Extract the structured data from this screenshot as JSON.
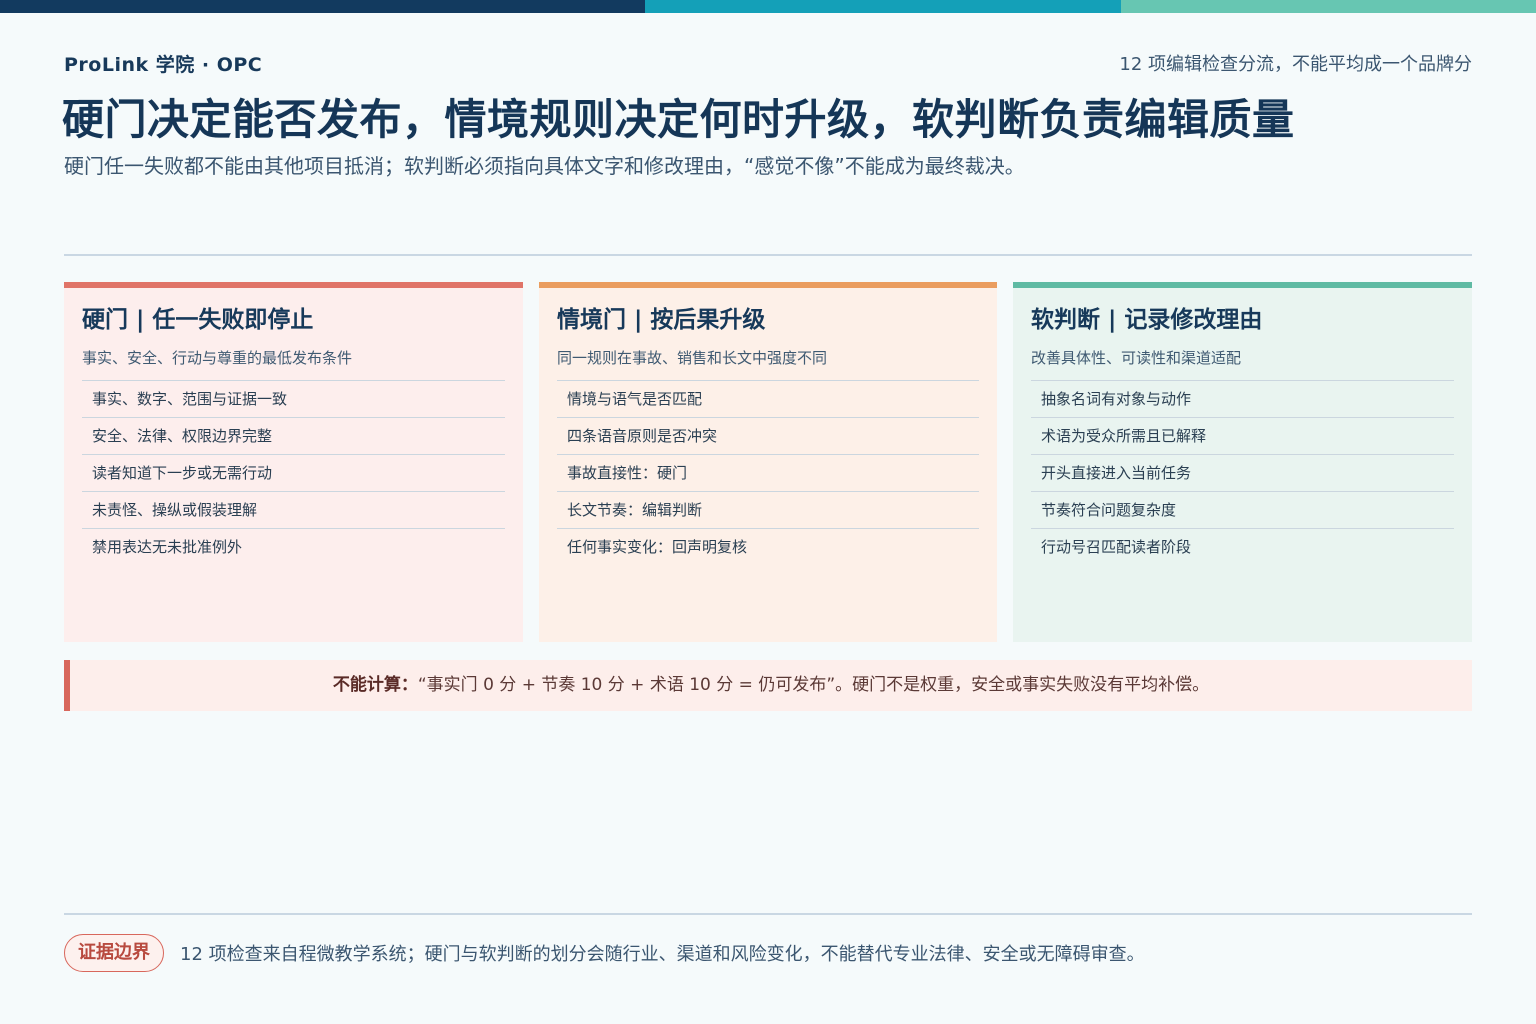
{
  "header": {
    "brand": "ProLink 学院 · OPC",
    "note": "12 项编辑检查分流，不能平均成一个品牌分",
    "title": "硬门决定能否发布，情境规则决定何时升级，软判断负责编辑质量",
    "subtitle": "硬门任一失败都不能由其他项目抵消；软判断必须指向具体文字和修改理由，“感觉不像”不能成为最终裁决。"
  },
  "cards": [
    {
      "title": "硬门 | 任一失败即停止",
      "desc": "事实、安全、行动与尊重的最低发布条件",
      "items": [
        "事实、数字、范围与证据一致",
        "安全、法律、权限边界完整",
        "读者知道下一步或无需行动",
        "未责怪、操纵或假装理解",
        "禁用表达无未批准例外"
      ]
    },
    {
      "title": "情境门 | 按后果升级",
      "desc": "同一规则在事故、销售和长文中强度不同",
      "items": [
        "情境与语气是否匹配",
        "四条语音原则是否冲突",
        "事故直接性：硬门",
        "长文节奏：编辑判断",
        "任何事实变化：回声明复核"
      ]
    },
    {
      "title": "软判断 | 记录修改理由",
      "desc": "改善具体性、可读性和渠道适配",
      "items": [
        "抽象名词有对象与动作",
        "术语为受众所需且已解释",
        "开头直接进入当前任务",
        "节奏符合问题复杂度",
        "行动号召匹配读者阶段"
      ]
    }
  ],
  "warning": {
    "label": "不能计算：",
    "text": "“事实门 0 分 + 节奏 10 分 + 术语 10 分 = 仍可发布”。硬门不是权重，安全或事实失败没有平均补偿。"
  },
  "footer": {
    "badge": "证据边界",
    "text": "12 项检查来自程微教学系统；硬门与软判断的划分会随行业、渠道和风险变化，不能替代专业法律、安全或无障碍审查。"
  }
}
